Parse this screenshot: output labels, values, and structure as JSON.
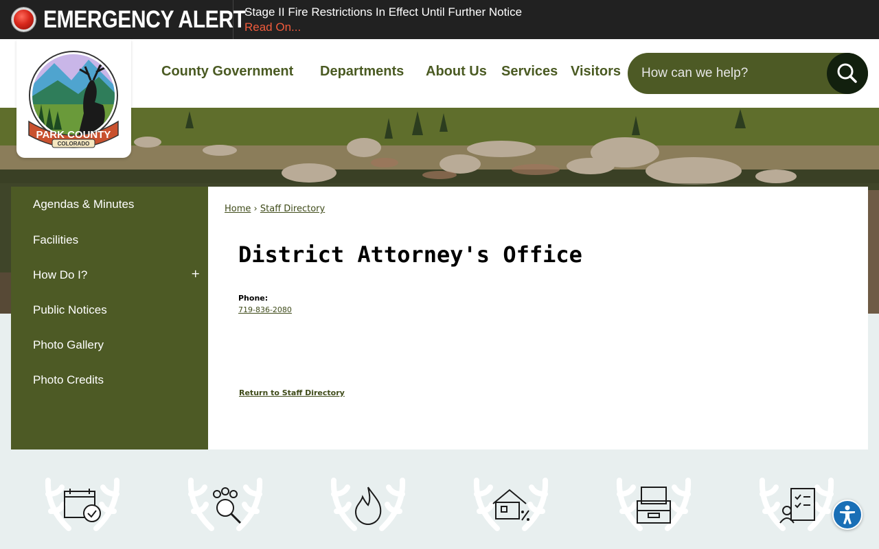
{
  "alert": {
    "title": "EMERGENCY ALERT",
    "message": "Stage II Fire Restrictions In Effect Until Further Notice",
    "link_label": "Read On..."
  },
  "logo": {
    "line1": "PARK COUNTY",
    "line2": "COLORADO"
  },
  "nav": {
    "items": [
      {
        "label": "County Government"
      },
      {
        "label": "Departments"
      },
      {
        "label": "About Us"
      },
      {
        "label": "Services"
      },
      {
        "label": "Visitors"
      }
    ]
  },
  "search": {
    "placeholder": "How can we help?",
    "icon": "search-icon"
  },
  "sidebar": {
    "items": [
      {
        "label": "Agendas & Minutes"
      },
      {
        "label": "Facilities"
      },
      {
        "label": "How Do I?",
        "expand": "+"
      },
      {
        "label": "Public Notices"
      },
      {
        "label": "Photo Gallery"
      },
      {
        "label": "Photo Credits"
      }
    ]
  },
  "breadcrumb": {
    "home": "Home",
    "sep": "›",
    "current": "Staff Directory"
  },
  "main": {
    "title": "District Attorney's Office",
    "phone_label": "Phone:",
    "phone": "719-836-2080",
    "return_label": "Return to Staff Directory"
  },
  "quick_links": {
    "icons": [
      "calendar-icon",
      "staff-search-icon",
      "fire-icon",
      "property-tax-icon",
      "records-icon",
      "checklist-icon"
    ]
  },
  "colors": {
    "brand_green": "#4d5a25",
    "alert_bg": "#212121",
    "alert_link": "#f15b3c",
    "accessibility_blue": "#1a6fb6"
  }
}
